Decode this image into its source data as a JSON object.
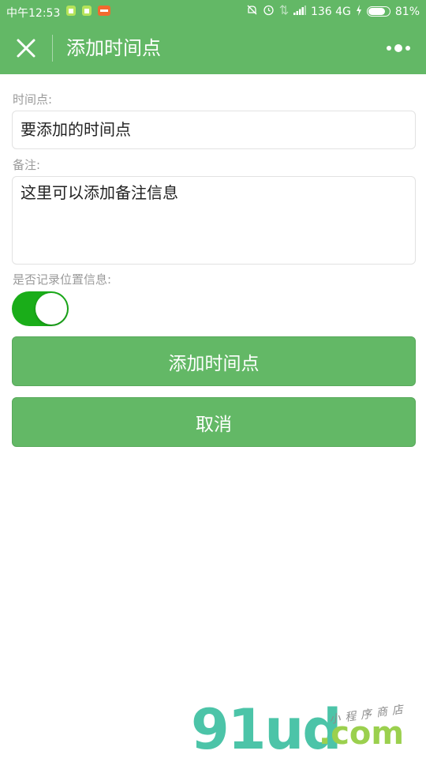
{
  "status_bar": {
    "time": "中午12:53",
    "network": "136 4G",
    "battery": "81%",
    "battery_level": 0.81
  },
  "nav": {
    "title": "添加时间点"
  },
  "form": {
    "time_label": "时间点:",
    "time_placeholder": "要添加的时间点",
    "note_label": "备注:",
    "note_placeholder": "这里可以添加备注信息",
    "location_label": "是否记录位置信息:",
    "location_enabled": true
  },
  "buttons": {
    "add": "添加时间点",
    "cancel": "取消"
  },
  "watermark": {
    "logo": "91ud",
    "suffix": ".com",
    "tagline": "小程序商店"
  },
  "colors": {
    "primary": "#63b866",
    "switch_on": "#1aad19"
  }
}
